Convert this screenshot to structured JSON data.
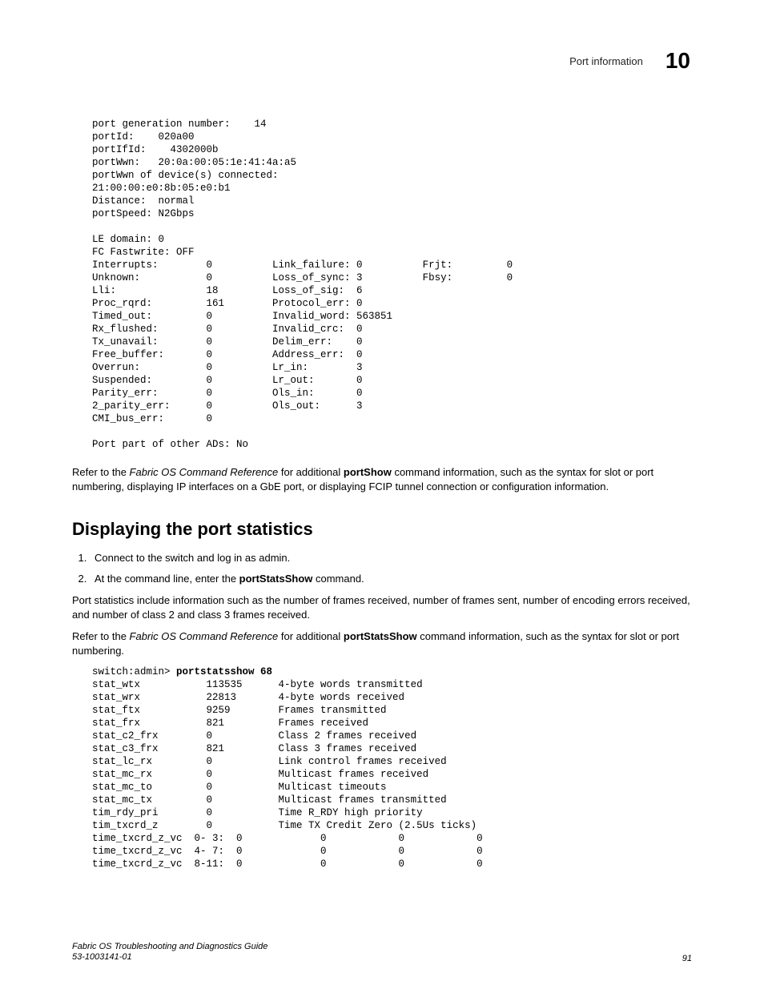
{
  "header": {
    "title": "Port information",
    "chapter": "10"
  },
  "code1": "port generation number:    14\nportId:    020a00\nportIfId:    4302000b\nportWwn:   20:0a:00:05:1e:41:4a:a5\nportWwn of device(s) connected:\n21:00:00:e0:8b:05:e0:b1\nDistance:  normal\nportSpeed: N2Gbps\n\nLE domain: 0\nFC Fastwrite: OFF\nInterrupts:        0          Link_failure: 0          Frjt:         0\nUnknown:           0          Loss_of_sync: 3          Fbsy:         0\nLli:               18         Loss_of_sig:  6\nProc_rqrd:         161        Protocol_err: 0\nTimed_out:         0          Invalid_word: 563851\nRx_flushed:        0          Invalid_crc:  0\nTx_unavail:        0          Delim_err:    0\nFree_buffer:       0          Address_err:  0\nOverrun:           0          Lr_in:        3\nSuspended:         0          Lr_out:       0\nParity_err:        0          Ols_in:       0\n2_parity_err:      0          Ols_out:      3\nCMI_bus_err:       0\n\nPort part of other ADs: No",
  "para1a": "Refer to the ",
  "para1b": "Fabric OS Command Reference",
  "para1c": " for additional ",
  "para1d": "portShow",
  "para1e": " command information, such as the syntax for slot or port numbering, displaying IP interfaces on a GbE port, or displaying FCIP tunnel connection or configuration information.",
  "section_heading": "Displaying the port statistics",
  "step1": "Connect to the switch and log in as admin.",
  "step2a": "At the command line, enter the ",
  "step2b": "portStatsShow",
  "step2c": " command.",
  "para2": "Port statistics include information such as the number of frames received, number of frames sent, number of encoding errors received, and number of class 2 and class 3 frames received.",
  "para3a": "Refer to the ",
  "para3b": "Fabric OS Command Reference",
  "para3c": " for additional ",
  "para3d": "portStatsShow",
  "para3e": " command information, such as the syntax for slot or port numbering.",
  "cmd_prompt": "switch:admin> ",
  "cmd_text": "portstatsshow 68",
  "code2": "stat_wtx           113535      4-byte words transmitted\nstat_wrx           22813       4-byte words received\nstat_ftx           9259        Frames transmitted\nstat_frx           821         Frames received\nstat_c2_frx        0           Class 2 frames received\nstat_c3_frx        821         Class 3 frames received\nstat_lc_rx         0           Link control frames received\nstat_mc_rx         0           Multicast frames received\nstat_mc_to         0           Multicast timeouts\nstat_mc_tx         0           Multicast frames transmitted\ntim_rdy_pri        0           Time R_RDY high priority\ntim_txcrd_z        0           Time TX Credit Zero (2.5Us ticks)\ntime_txcrd_z_vc  0- 3:  0             0            0            0\ntime_txcrd_z_vc  4- 7:  0             0            0            0\ntime_txcrd_z_vc  8-11:  0             0            0            0",
  "footer": {
    "title": "Fabric OS Troubleshooting and Diagnostics Guide",
    "docnum": "53-1003141-01",
    "page": "91"
  }
}
